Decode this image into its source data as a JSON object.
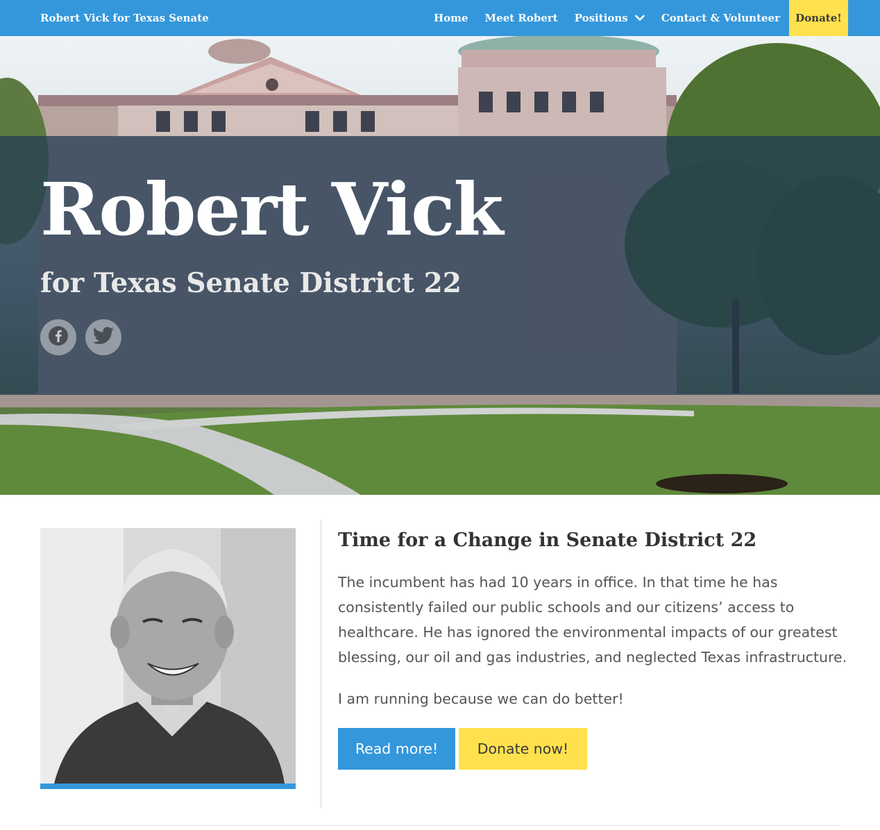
{
  "nav": {
    "brand": "Robert Vick for Texas Senate",
    "items": [
      {
        "label": "Home"
      },
      {
        "label": "Meet Robert"
      },
      {
        "label": "Positions"
      },
      {
        "label": "Contact & Volunteer"
      }
    ],
    "donate_label": "Donate!"
  },
  "hero": {
    "title": "Robert Vick",
    "subtitle": "for Texas Senate District 22",
    "social": [
      "facebook-icon",
      "twitter-icon"
    ]
  },
  "article": {
    "title": "Time for a Change in Senate District 22",
    "paragraph1": "The incumbent has had 10 years in office. In that time he has consistently failed our public schools and our citizens’ access to healthcare. He has ignored the environmental impacts of our greatest blessing, our oil and gas industries, and neglected Texas infrastructure.",
    "paragraph2": "I am running because we can do better!",
    "read_more_label": "Read more!",
    "donate_now_label": "Donate now!"
  },
  "colors": {
    "primary": "#3497db",
    "accent": "#ffe04d",
    "overlay": "#223a54",
    "text": "#333333"
  }
}
